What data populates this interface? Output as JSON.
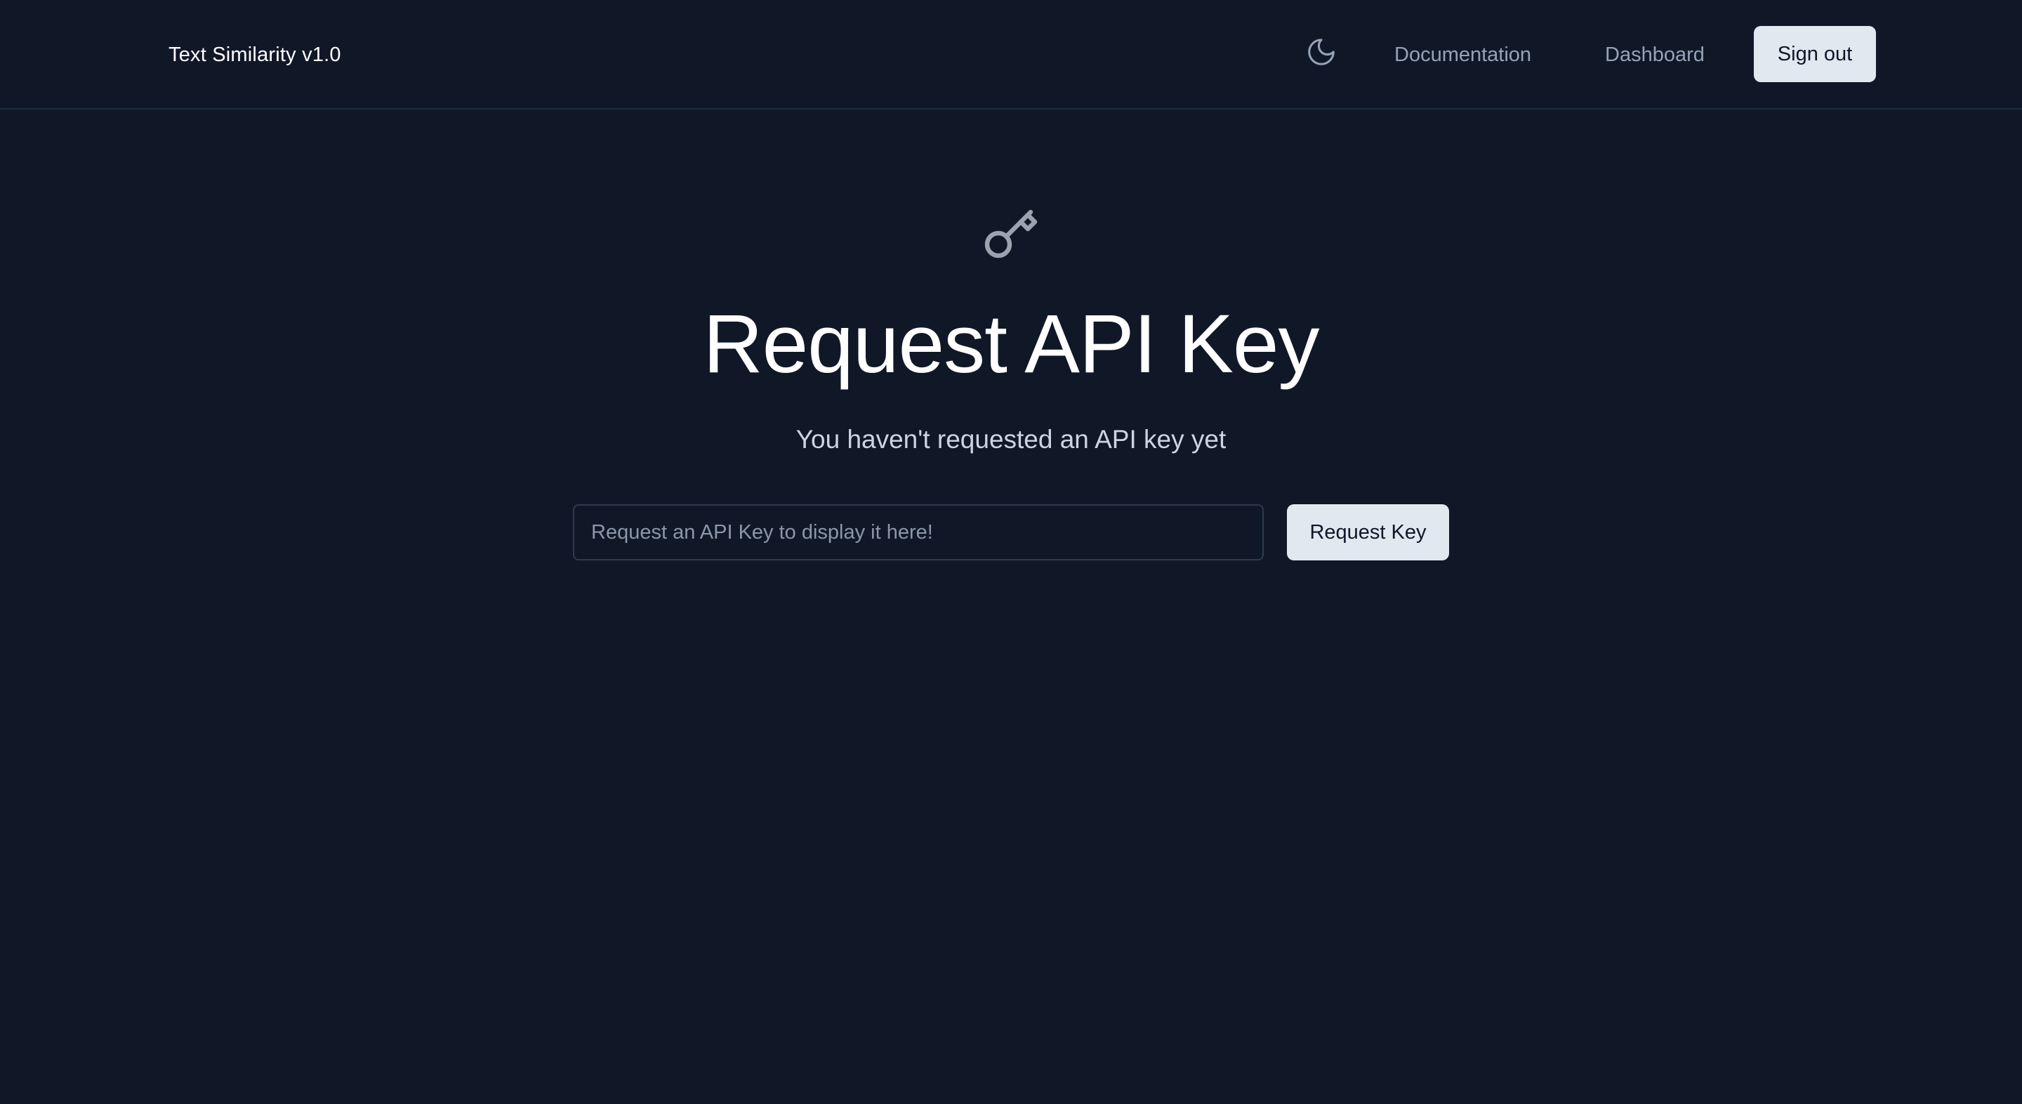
{
  "header": {
    "brand": "Text Similarity v1.0",
    "theme_toggle_icon": "moon-icon",
    "nav": {
      "documentation": "Documentation",
      "dashboard": "Dashboard"
    },
    "signout_label": "Sign out"
  },
  "main": {
    "icon": "key-icon",
    "title": "Request API Key",
    "subtitle": "You haven't requested an API key yet",
    "input": {
      "value": "",
      "placeholder": "Request an API Key to display it here!"
    },
    "request_button_label": "Request Key"
  },
  "colors": {
    "background": "#101828",
    "border": "#1f2f3f",
    "button_bg": "#e2e8f0",
    "button_text": "#0f172a",
    "muted_text": "#94a3b8",
    "icon": "#9ca3af"
  }
}
